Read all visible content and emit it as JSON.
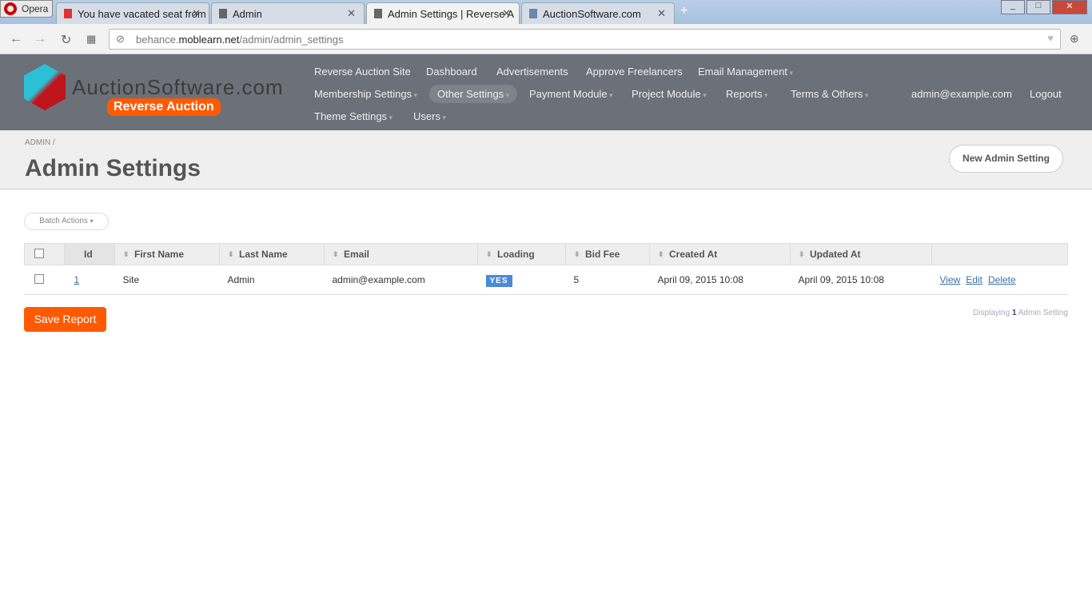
{
  "browser": {
    "brand": "Opera",
    "tabs": [
      {
        "title": "You have vacated seat from"
      },
      {
        "title": "Admin"
      },
      {
        "title": "Admin Settings | Reverse A"
      },
      {
        "title": "AuctionSoftware.com"
      }
    ],
    "url_prefix": "behance.",
    "url_domain": "moblearn.net",
    "url_path": "/admin/admin_settings"
  },
  "logo": {
    "text": "AuctionSoftware.com",
    "badge": "Reverse Auction"
  },
  "menu": {
    "items": [
      "Reverse Auction Site",
      "Dashboard",
      "Advertisements",
      "Approve Freelancers",
      "Email Management",
      "Membership Settings",
      "Other Settings",
      "Payment Module",
      "Project Module",
      "Reports",
      "Terms & Others",
      "Theme Settings",
      "Users"
    ],
    "user": "admin@example.com",
    "logout": "Logout"
  },
  "page": {
    "breadcrumb": "ADMIN",
    "title": "Admin Settings",
    "new_button": "New Admin Setting",
    "batch_actions": "Batch Actions"
  },
  "table": {
    "columns": [
      "Id",
      "First Name",
      "Last Name",
      "Email",
      "Loading",
      "Bid Fee",
      "Created At",
      "Updated At"
    ],
    "rows": [
      {
        "id": "1",
        "first_name": "Site",
        "last_name": "Admin",
        "email": "admin@example.com",
        "loading": "YES",
        "bid_fee": "5",
        "created_at": "April 09, 2015 10:08",
        "updated_at": "April 09, 2015 10:08",
        "actions": [
          "View",
          "Edit",
          "Delete"
        ]
      }
    ]
  },
  "footer": {
    "save_report": "Save Report",
    "displaying_prefix": "Displaying",
    "count": "1",
    "displaying_suffix": "Admin Setting"
  }
}
